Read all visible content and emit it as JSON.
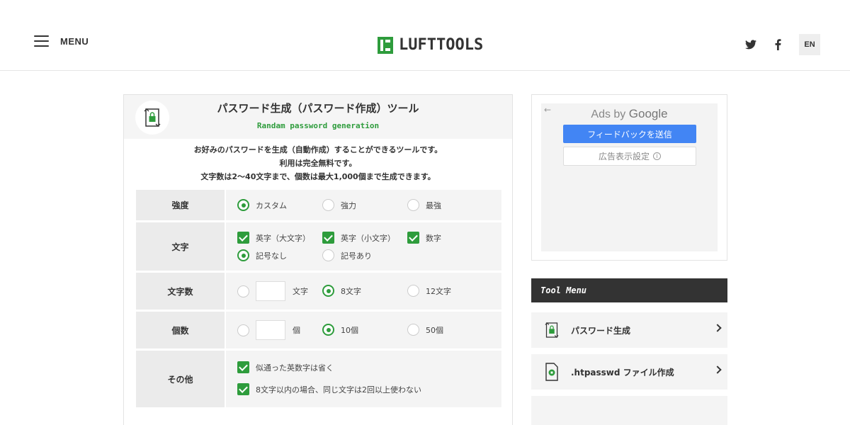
{
  "header": {
    "menu_label": "MENU",
    "logo_text": "LUFTTOOLS",
    "lang_label": "EN",
    "icons": [
      "twitter-icon",
      "facebook-icon"
    ]
  },
  "card": {
    "title": "パスワード生成（パスワード作成）ツール",
    "subtitle": "Randam password generation",
    "description": [
      "お好みのパスワードを生成（自動作成）することができるツールです。",
      "利用は完全無料です。",
      "文字数は2〜40文字まで、個数は最大1,000個まで生成できます。"
    ]
  },
  "form": {
    "strength": {
      "label": "強度",
      "options": [
        "カスタム",
        "強力",
        "最強"
      ],
      "selected": 0
    },
    "chars": {
      "label": "文字",
      "checks": [
        "英字（大文字）",
        "英字（小文字）",
        "数字"
      ],
      "symbols": [
        "記号なし",
        "記号あり"
      ],
      "symbols_selected": 0
    },
    "length": {
      "label": "文字数",
      "custom_unit": "文字",
      "options": [
        "8文字",
        "12文字"
      ],
      "selected": 0
    },
    "count": {
      "label": "個数",
      "custom_unit": "個",
      "options": [
        "10個",
        "50個"
      ],
      "selected": 0
    },
    "other": {
      "label": "その他",
      "checks": [
        "似通った英数字は省く",
        "8文字以内の場合、同じ文字は2回以上使わない"
      ]
    }
  },
  "ad": {
    "back_arrow": "←",
    "ads_by": "Ads by",
    "google": "Google",
    "feedback_label": "フィードバックを送信",
    "settings_label": "広告表示設定",
    "info_glyph": "i"
  },
  "tool_menu": {
    "heading": "Tool Menu",
    "items": [
      {
        "label": "パスワード生成",
        "icon": "password-lock-icon"
      },
      {
        "label": ".htpasswd ファイル作成",
        "icon": "htpasswd-file-icon"
      }
    ]
  },
  "colors": {
    "accent": "#2e9c3c",
    "dark": "#333333",
    "google_blue": "#4285f4"
  }
}
